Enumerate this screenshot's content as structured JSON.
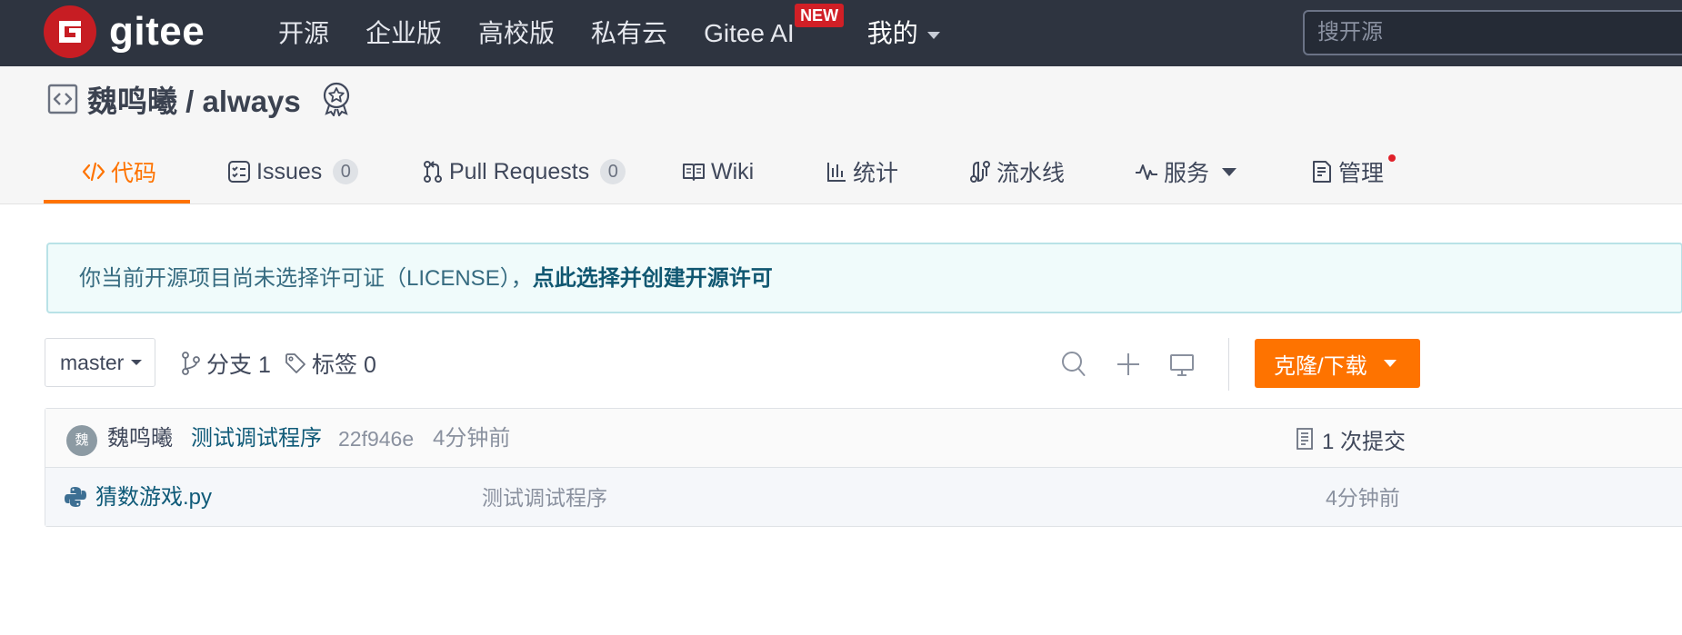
{
  "brand": {
    "name": "gitee",
    "color": "#c71d23"
  },
  "nav": {
    "items": [
      "开源",
      "企业版",
      "高校版",
      "私有云"
    ],
    "ai_label": "Gitee AI",
    "ai_badge": "NEW",
    "mine_label": "我的"
  },
  "search": {
    "placeholder": "搜开源"
  },
  "project": {
    "title": "魏鸣曦 / always",
    "tabs": {
      "code": "代码",
      "issues": "Issues",
      "issues_count": "0",
      "pulls": "Pull Requests",
      "pulls_count": "0",
      "wiki": "Wiki",
      "stats": "统计",
      "pipeline": "流水线",
      "services": "服务",
      "manage": "管理"
    }
  },
  "notice": {
    "text": "你当前开源项目尚未选择许可证（LICENSE），",
    "link": "点此选择并创建开源许可"
  },
  "toolbar": {
    "branch": "master",
    "branches_label": "分支 1",
    "tags_label": "标签 0",
    "clone_label": "克隆/下载"
  },
  "commit": {
    "avatar_char": "魏",
    "author": "魏鸣曦",
    "message": "测试调试程序",
    "hash": "22f946e",
    "time": "4分钟前",
    "count_label": "1 次提交"
  },
  "files": [
    {
      "name": "猜数游戏.py",
      "message": "测试调试程序",
      "time": "4分钟前",
      "icon": "python-icon"
    }
  ],
  "colors": {
    "topbar": "#2e3440",
    "accent": "#fe7300",
    "link": "#0f5a78"
  }
}
